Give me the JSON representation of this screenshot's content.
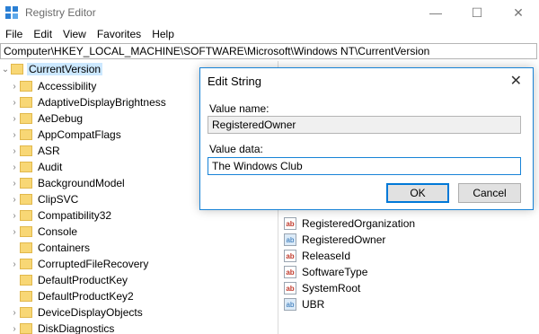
{
  "window": {
    "title": "Registry Editor",
    "controls": {
      "minimize": "—",
      "maximize": "☐",
      "close": "✕"
    }
  },
  "menu": [
    "File",
    "Edit",
    "View",
    "Favorites",
    "Help"
  ],
  "address": "Computer\\HKEY_LOCAL_MACHINE\\SOFTWARE\\Microsoft\\Windows NT\\CurrentVersion",
  "tree": {
    "root": "CurrentVersion",
    "items": [
      "Accessibility",
      "AdaptiveDisplayBrightness",
      "AeDebug",
      "AppCompatFlags",
      "ASR",
      "Audit",
      "BackgroundModel",
      "ClipSVC",
      "Compatibility32",
      "Console",
      "Containers",
      "CorruptedFileRecovery",
      "DefaultProductKey",
      "DefaultProductKey2",
      "DeviceDisplayObjects",
      "DiskDiagnostics"
    ]
  },
  "values": [
    {
      "name": "RegisteredOrganization",
      "icon": "string-value-icon"
    },
    {
      "name": "RegisteredOwner",
      "icon": "binary-value-icon"
    },
    {
      "name": "ReleaseId",
      "icon": "string-value-icon"
    },
    {
      "name": "SoftwareType",
      "icon": "string-value-icon"
    },
    {
      "name": "SystemRoot",
      "icon": "string-value-icon"
    },
    {
      "name": "UBR",
      "icon": "binary-value-icon"
    }
  ],
  "dialog": {
    "title": "Edit String",
    "value_name_label": "Value name:",
    "value_name": "RegisteredOwner",
    "value_data_label": "Value data:",
    "value_data": "The Windows Club",
    "ok": "OK",
    "cancel": "Cancel",
    "close": "✕"
  },
  "colors": {
    "accent": "#0078d7",
    "selection": "#cce8ff",
    "folder": "#f8d775"
  }
}
